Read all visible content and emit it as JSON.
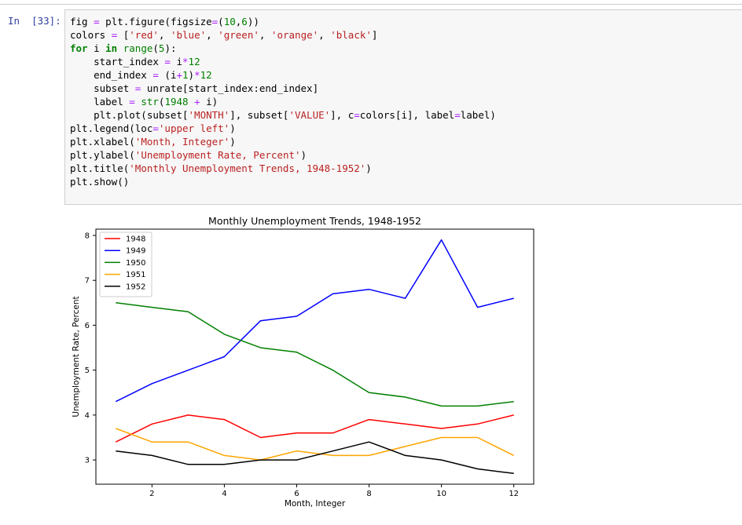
{
  "cell": {
    "prompt": "In  [33]:",
    "code_lines": [
      [
        [
          "t",
          "fig "
        ],
        [
          "op",
          "="
        ],
        [
          "t",
          " plt."
        ],
        [
          "t",
          "figure(figsize"
        ],
        [
          "op",
          "="
        ],
        [
          "t",
          "("
        ],
        [
          "num",
          "10"
        ],
        [
          "t",
          ","
        ],
        [
          "num",
          "6"
        ],
        [
          "t",
          "))"
        ]
      ],
      [
        [
          "t",
          "colors "
        ],
        [
          "op",
          "="
        ],
        [
          "t",
          " ["
        ],
        [
          "str",
          "'red'"
        ],
        [
          "t",
          ", "
        ],
        [
          "str",
          "'blue'"
        ],
        [
          "t",
          ", "
        ],
        [
          "str",
          "'green'"
        ],
        [
          "t",
          ", "
        ],
        [
          "str",
          "'orange'"
        ],
        [
          "t",
          ", "
        ],
        [
          "str",
          "'black'"
        ],
        [
          "t",
          "]"
        ]
      ],
      [
        [
          "kw",
          "for"
        ],
        [
          "t",
          " i "
        ],
        [
          "kw",
          "in"
        ],
        [
          "t",
          " "
        ],
        [
          "bi",
          "range"
        ],
        [
          "t",
          "("
        ],
        [
          "num",
          "5"
        ],
        [
          "t",
          "):"
        ]
      ],
      [
        [
          "t",
          "    start_index "
        ],
        [
          "op",
          "="
        ],
        [
          "t",
          " i"
        ],
        [
          "op",
          "*"
        ],
        [
          "num",
          "12"
        ]
      ],
      [
        [
          "t",
          "    end_index "
        ],
        [
          "op",
          "="
        ],
        [
          "t",
          " (i"
        ],
        [
          "op",
          "+"
        ],
        [
          "num",
          "1"
        ],
        [
          "t",
          ")"
        ],
        [
          "op",
          "*"
        ],
        [
          "num",
          "12"
        ]
      ],
      [
        [
          "t",
          "    subset "
        ],
        [
          "op",
          "="
        ],
        [
          "t",
          " unrate[start_index:end_index]"
        ]
      ],
      [
        [
          "t",
          "    label "
        ],
        [
          "op",
          "="
        ],
        [
          "t",
          " "
        ],
        [
          "bi",
          "str"
        ],
        [
          "t",
          "("
        ],
        [
          "num",
          "1948"
        ],
        [
          "t",
          " "
        ],
        [
          "op",
          "+"
        ],
        [
          "t",
          " i)"
        ]
      ],
      [
        [
          "t",
          "    plt.plot(subset["
        ],
        [
          "str",
          "'MONTH'"
        ],
        [
          "t",
          "], subset["
        ],
        [
          "str",
          "'VALUE'"
        ],
        [
          "t",
          "], c"
        ],
        [
          "op",
          "="
        ],
        [
          "t",
          "colors[i], label"
        ],
        [
          "op",
          "="
        ],
        [
          "t",
          "label)"
        ]
      ],
      [
        [
          "t",
          "plt.legend(loc"
        ],
        [
          "op",
          "="
        ],
        [
          "str",
          "'upper left'"
        ],
        [
          "t",
          ")"
        ]
      ],
      [
        [
          "t",
          "plt.xlabel("
        ],
        [
          "str",
          "'Month, Integer'"
        ],
        [
          "t",
          ")"
        ]
      ],
      [
        [
          "t",
          "plt.ylabel("
        ],
        [
          "str",
          "'Unemployment Rate, Percent'"
        ],
        [
          "t",
          ")"
        ]
      ],
      [
        [
          "t",
          "plt.title("
        ],
        [
          "str",
          "'Monthly Unemployment Trends, 1948-1952'"
        ],
        [
          "t",
          ")"
        ]
      ],
      [
        [
          "t",
          "plt.show()"
        ]
      ]
    ]
  },
  "chart_data": {
    "type": "line",
    "title": "Monthly Unemployment Trends, 1948-1952",
    "xlabel": "Month, Integer",
    "ylabel": "Unemployment Rate, Percent",
    "x": [
      1,
      2,
      3,
      4,
      5,
      6,
      7,
      8,
      9,
      10,
      11,
      12
    ],
    "xlim": [
      0.45,
      12.55
    ],
    "ylim": [
      2.46,
      8.14
    ],
    "xticks": [
      2,
      4,
      6,
      8,
      10,
      12
    ],
    "yticks": [
      3,
      4,
      5,
      6,
      7,
      8
    ],
    "grid": false,
    "legend_position": "upper left",
    "series": [
      {
        "name": "1948",
        "color": "#ff0000",
        "values": [
          3.4,
          3.8,
          4.0,
          3.9,
          3.5,
          3.6,
          3.6,
          3.9,
          3.8,
          3.7,
          3.8,
          4.0
        ]
      },
      {
        "name": "1949",
        "color": "#0000ff",
        "values": [
          4.3,
          4.7,
          5.0,
          5.3,
          6.1,
          6.2,
          6.7,
          6.8,
          6.6,
          7.9,
          6.4,
          6.6
        ]
      },
      {
        "name": "1950",
        "color": "#008000",
        "values": [
          6.5,
          6.4,
          6.3,
          5.8,
          5.5,
          5.4,
          5.0,
          4.5,
          4.4,
          4.2,
          4.2,
          4.3
        ]
      },
      {
        "name": "1951",
        "color": "#ffa500",
        "values": [
          3.7,
          3.4,
          3.4,
          3.1,
          3.0,
          3.2,
          3.1,
          3.1,
          3.3,
          3.5,
          3.5,
          3.1
        ]
      },
      {
        "name": "1952",
        "color": "#000000",
        "values": [
          3.2,
          3.1,
          2.9,
          2.9,
          3.0,
          3.0,
          3.2,
          3.4,
          3.1,
          3.0,
          2.8,
          2.7
        ]
      }
    ]
  }
}
